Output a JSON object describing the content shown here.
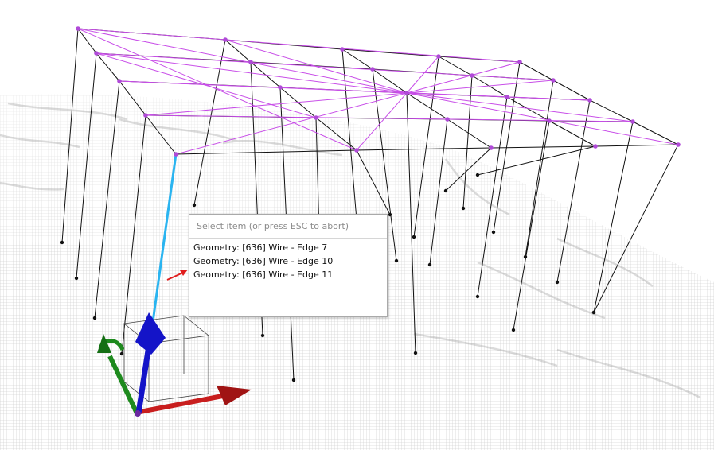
{
  "selection_popup": {
    "placeholder": "Select item (or press ESC to abort)",
    "items": [
      {
        "label": "Geometry: [636] Wire - Edge 7"
      },
      {
        "label": "Geometry: [636] Wire - Edge 10"
      },
      {
        "label": "Geometry: [636] Wire - Edge 11"
      }
    ]
  },
  "colors": {
    "frame_edge": "#111111",
    "brace_edge": "#c84ee8",
    "vertex": "#b04ad8",
    "highlighted_edge": "#2ab4f0",
    "gizmo_x": "#c81e1e",
    "gizmo_y": "#1e8a1e",
    "gizmo_z": "#1414c8",
    "indicator_arrow": "#e01e1e"
  },
  "icons": [
    "pointer-arrow-icon",
    "transform-gizmo"
  ]
}
